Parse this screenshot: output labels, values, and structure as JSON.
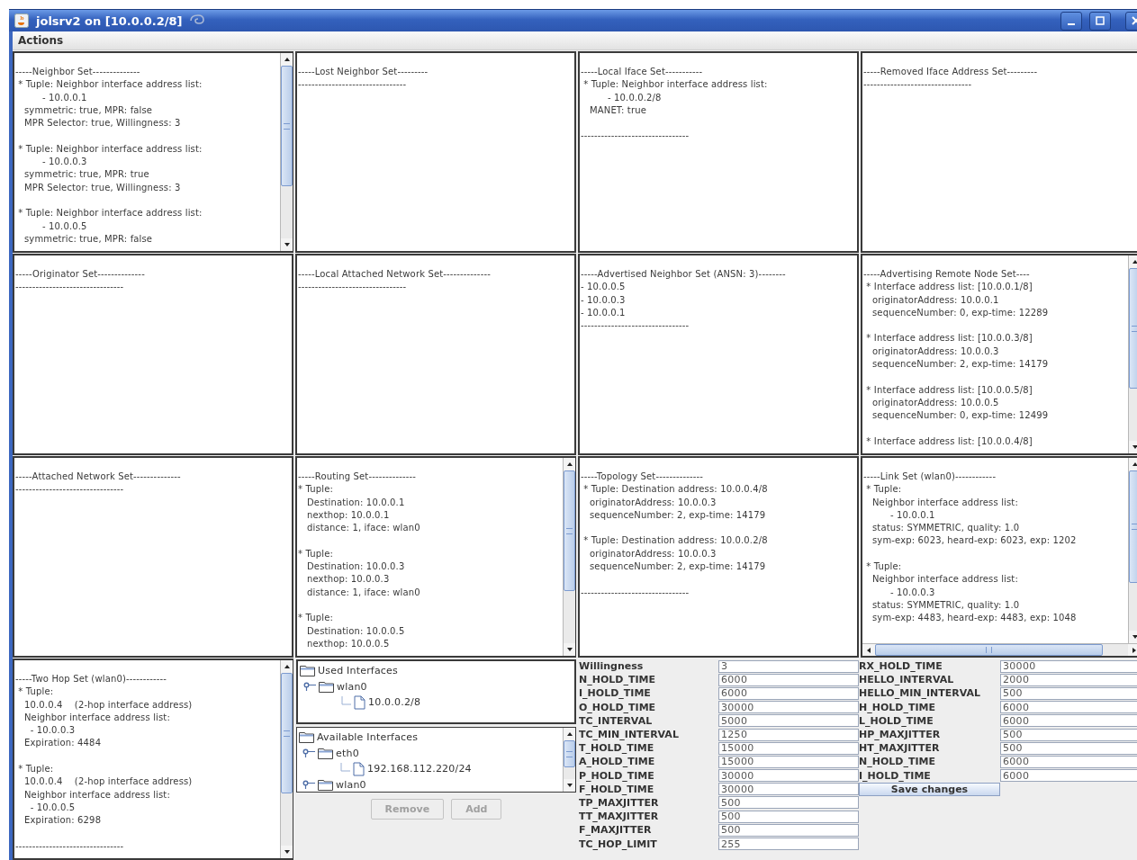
{
  "window": {
    "title": "jolsrv2 on [10.0.0.2/8]"
  },
  "menu_bar": [
    "Actions"
  ],
  "panels": [
    {
      "vertical_scrollbar": true,
      "blocks": [
        [
          "-----Neighbor Set--------------",
          " * Tuple: Neighbor interface address list:",
          "         - 10.0.0.1",
          "   symmetric: true, MPR: false",
          "   MPR Selector: true, Willingness: 3"
        ],
        [
          " * Tuple: Neighbor interface address list:",
          "         - 10.0.0.3",
          "   symmetric: true, MPR: true",
          "   MPR Selector: true, Willingness: 3"
        ],
        [
          " * Tuple: Neighbor interface address list:",
          "         - 10.0.0.5",
          "   symmetric: true, MPR: false"
        ]
      ]
    },
    {
      "blocks": [
        [
          "-----Lost Neighbor Set---------",
          "--------------------------------"
        ]
      ]
    },
    {
      "blocks": [
        [
          "-----Local Iface Set-----------",
          " * Tuple: Neighbor interface address list:",
          "         - 10.0.0.2/8",
          "   MANET: true"
        ],
        [
          "--------------------------------"
        ]
      ]
    },
    {
      "blocks": [
        [
          "-----Removed Iface Address Set---------",
          "--------------------------------"
        ]
      ]
    },
    {
      "blocks": [
        [
          "-----Originator Set--------------",
          "--------------------------------"
        ]
      ]
    },
    {
      "blocks": [
        [
          "-----Local Attached Network Set--------------",
          "--------------------------------"
        ]
      ]
    },
    {
      "blocks": [
        [
          "-----Advertised Neighbor Set (ANSN: 3)--------",
          "- 10.0.0.5",
          "- 10.0.0.3",
          "- 10.0.0.1",
          "--------------------------------"
        ]
      ]
    },
    {
      "vertical_scrollbar": true,
      "blocks": [
        [
          "-----Advertising Remote Node Set----",
          " * Interface address list: [10.0.0.1/8]",
          "   originatorAddress: 10.0.0.1",
          "   sequenceNumber: 0, exp-time: 12289"
        ],
        [
          " * Interface address list: [10.0.0.3/8]",
          "   originatorAddress: 10.0.0.3",
          "   sequenceNumber: 2, exp-time: 14179"
        ],
        [
          " * Interface address list: [10.0.0.5/8]",
          "   originatorAddress: 10.0.0.5",
          "   sequenceNumber: 0, exp-time: 12499"
        ],
        [
          " * Interface address list: [10.0.0.4/8]"
        ]
      ]
    },
    {
      "blocks": [
        [
          "-----Attached Network Set--------------",
          "--------------------------------"
        ]
      ]
    },
    {
      "vertical_scrollbar": true,
      "blocks": [
        [
          "-----Routing Set--------------",
          "* Tuple:",
          "   Destination: 10.0.0.1",
          "   nexthop: 10.0.0.1",
          "   distance: 1, iface: wlan0"
        ],
        [
          "* Tuple:",
          "   Destination: 10.0.0.3",
          "   nexthop: 10.0.0.3",
          "   distance: 1, iface: wlan0"
        ],
        [
          "* Tuple:",
          "   Destination: 10.0.0.5",
          "   nexthop: 10.0.0.5"
        ]
      ]
    },
    {
      "blocks": [
        [
          "-----Topology Set--------------",
          " * Tuple: Destination address: 10.0.0.4/8",
          "   originatorAddress: 10.0.0.3",
          "   sequenceNumber: 2, exp-time: 14179"
        ],
        [
          " * Tuple: Destination address: 10.0.0.2/8",
          "   originatorAddress: 10.0.0.3",
          "   sequenceNumber: 2, exp-time: 14179"
        ],
        [
          "--------------------------------"
        ]
      ]
    },
    {
      "vertical_scrollbar": true,
      "horizontal_scrollbar": true,
      "blocks": [
        [
          "-----Link Set (wlan0)------------",
          " * Tuple:",
          "   Neighbor interface address list:",
          "         - 10.0.0.1",
          "   status: SYMMETRIC, quality: 1.0",
          "   sym-exp: 6023, heard-exp: 6023, exp: 1202"
        ],
        [
          " * Tuple:",
          "   Neighbor interface address list:",
          "         - 10.0.0.3",
          "   status: SYMMETRIC, quality: 1.0",
          "   sym-exp: 4483, heard-exp: 4483, exp: 1048"
        ]
      ]
    },
    {
      "vertical_scrollbar": true,
      "blocks": [
        [
          "-----Two Hop Set (wlan0)------------",
          " * Tuple:",
          "   10.0.0.4    (2-hop interface address)",
          "   Neighbor interface address list:",
          "     - 10.0.0.3",
          "   Expiration: 4484"
        ],
        [
          " * Tuple:",
          "   10.0.0.4    (2-hop interface address)",
          "   Neighbor interface address list:",
          "     - 10.0.0.5",
          "   Expiration: 6298"
        ],
        [
          "--------------------------------"
        ]
      ]
    }
  ],
  "used_interfaces": {
    "label": "Used Interfaces",
    "kind": "folder",
    "children": [
      {
        "label": "wlan0",
        "kind": "folder",
        "children": [
          {
            "label": "10.0.0.2/8",
            "kind": "file"
          }
        ]
      }
    ]
  },
  "available_interfaces": {
    "label": "Available Interfaces",
    "kind": "folder",
    "children": [
      {
        "label": "eth0",
        "kind": "folder",
        "children": [
          {
            "label": "192.168.112.220/24",
            "kind": "file"
          }
        ]
      },
      {
        "label": "wlan0",
        "kind": "folder"
      }
    ]
  },
  "interface_buttons": [
    {
      "label": "Remove",
      "disabled": true
    },
    {
      "label": "Add",
      "disabled": true
    }
  ],
  "parameters": {
    "left": [
      {
        "label": "Willingness",
        "value": "3"
      },
      {
        "label": "N_HOLD_TIME",
        "value": "6000"
      },
      {
        "label": "I_HOLD_TIME",
        "value": "6000"
      },
      {
        "label": "O_HOLD_TIME",
        "value": "30000"
      },
      {
        "label": "TC_INTERVAL",
        "value": "5000"
      },
      {
        "label": "TC_MIN_INTERVAL",
        "value": "1250"
      },
      {
        "label": "T_HOLD_TIME",
        "value": "15000"
      },
      {
        "label": "A_HOLD_TIME",
        "value": "15000"
      },
      {
        "label": "P_HOLD_TIME",
        "value": "30000"
      },
      {
        "label": "F_HOLD_TIME",
        "value": "30000"
      },
      {
        "label": "TP_MAXJITTER",
        "value": "500"
      },
      {
        "label": "TT_MAXJITTER",
        "value": "500"
      },
      {
        "label": "F_MAXJITTER",
        "value": "500"
      },
      {
        "label": "TC_HOP_LIMIT",
        "value": "255"
      }
    ],
    "right": [
      {
        "label": "RX_HOLD_TIME",
        "value": "30000"
      },
      {
        "label": "HELLO_INTERVAL",
        "value": "2000"
      },
      {
        "label": "HELLO_MIN_INTERVAL",
        "value": "500"
      },
      {
        "label": "H_HOLD_TIME",
        "value": "6000"
      },
      {
        "label": "L_HOLD_TIME",
        "value": "6000"
      },
      {
        "label": "HP_MAXJITTER",
        "value": "500"
      },
      {
        "label": "HT_MAXJITTER",
        "value": "500"
      },
      {
        "label": "N_HOLD_TIME",
        "value": "6000"
      },
      {
        "label": "I_HOLD_TIME",
        "value": "6000"
      }
    ],
    "save_button": "Save changes"
  }
}
